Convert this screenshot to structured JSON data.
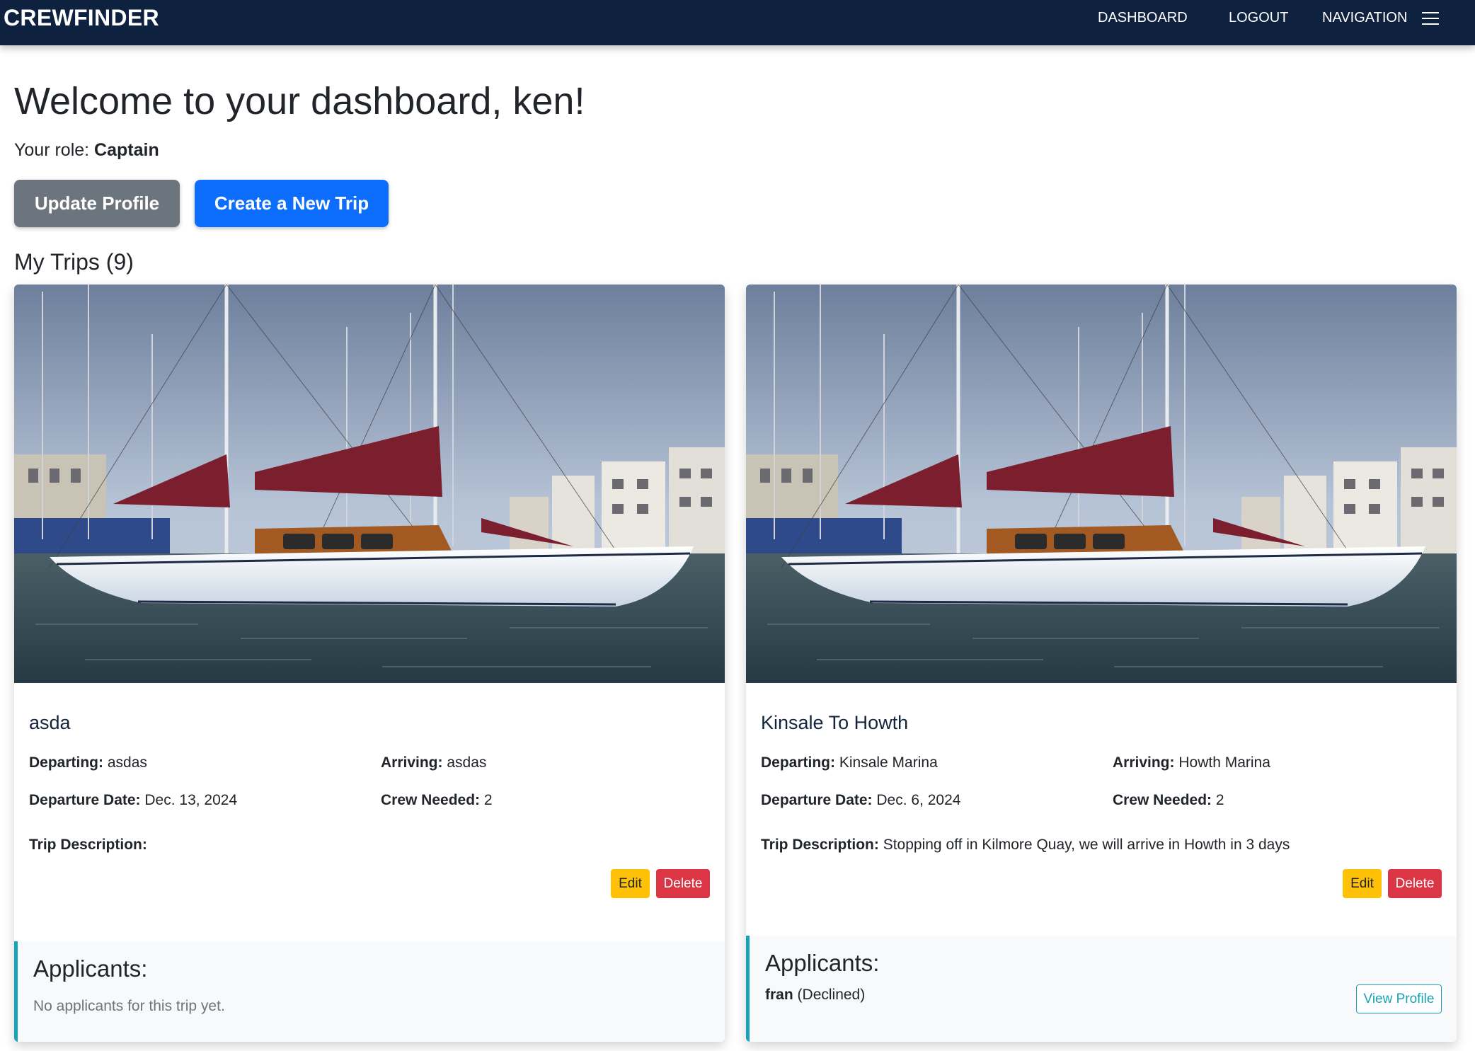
{
  "navbar": {
    "brand": "CREWFINDER",
    "links": [
      "DASHBOARD",
      "LOGOUT",
      "NAVIGATION"
    ],
    "menu_icon": "hamburger-menu-icon"
  },
  "welcome": "Welcome to your dashboard, ken!",
  "role": {
    "label": "Your role:",
    "value": "Captain"
  },
  "actions": {
    "update_profile": "Update Profile",
    "create_trip": "Create a New Trip"
  },
  "trips_heading": "My Trips (9)",
  "labels": {
    "departing": "Departing:",
    "arriving": "Arriving:",
    "departure_date": "Departure Date:",
    "crew_needed": "Crew Needed:",
    "trip_description": "Trip Description:",
    "edit": "Edit",
    "delete": "Delete",
    "applicants": "Applicants:",
    "view_profile": "View Profile"
  },
  "trips": [
    {
      "title": "asda",
      "departing": "asdas",
      "arriving": "asdas",
      "departure_date": "Dec. 13, 2024",
      "crew_needed": "2",
      "description": "",
      "no_applicants": "No applicants for this trip yet."
    },
    {
      "title": "Kinsale To Howth",
      "departing": "Kinsale Marina",
      "arriving": "Howth Marina",
      "departure_date": "Dec. 6, 2024",
      "crew_needed": "2",
      "description": "Stopping off in Kilmore Quay, we will arrive in Howth in 3 days",
      "applicants": [
        {
          "name": "fran",
          "status": "(Declined)"
        }
      ]
    }
  ],
  "colors": {
    "navbar": "#0e2240",
    "primary": "#0d6efd",
    "secondary": "#6c757d",
    "warning": "#ffc107",
    "danger": "#dc3545",
    "info": "#17a2b8"
  }
}
